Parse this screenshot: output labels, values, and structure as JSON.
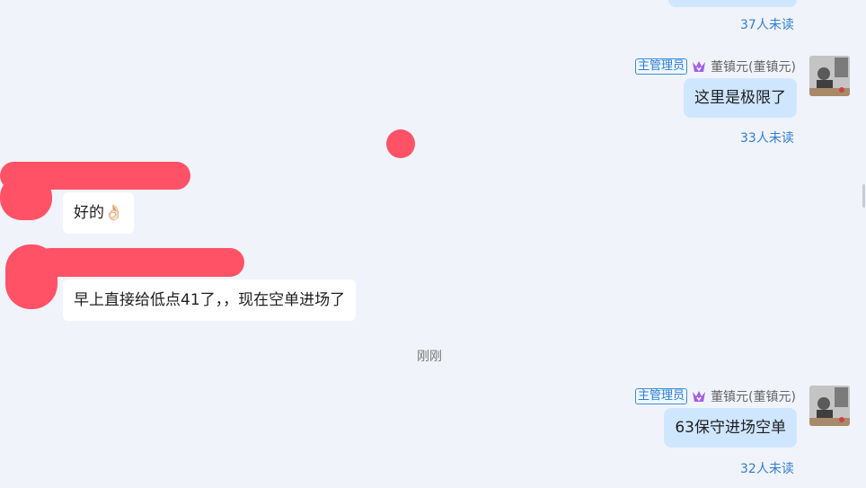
{
  "messages_right": [
    {
      "unread": "37人未读"
    },
    {
      "role_badge": "主管理员",
      "sender": "董镇元(董镇元)",
      "text": "这里是极限了",
      "unread": "33人未读"
    },
    {
      "role_badge": "主管理员",
      "sender": "董镇元(董镇元)",
      "text": "63保守进场空单",
      "unread": "32人未读"
    }
  ],
  "messages_left": [
    {
      "text": "好的👌🏻"
    },
    {
      "text": "早上直接给低点41了，，现在空单进场了"
    }
  ],
  "time_separator": "刚刚",
  "colors": {
    "background": "#f1f3fa",
    "bubble_self": "#cfe6ff",
    "bubble_other": "#ffffff",
    "unread_text": "#2d7fd3",
    "redaction": "#ff5266"
  },
  "icons": {
    "vip": "vip-crown-icon",
    "avatar": "user-avatar"
  }
}
